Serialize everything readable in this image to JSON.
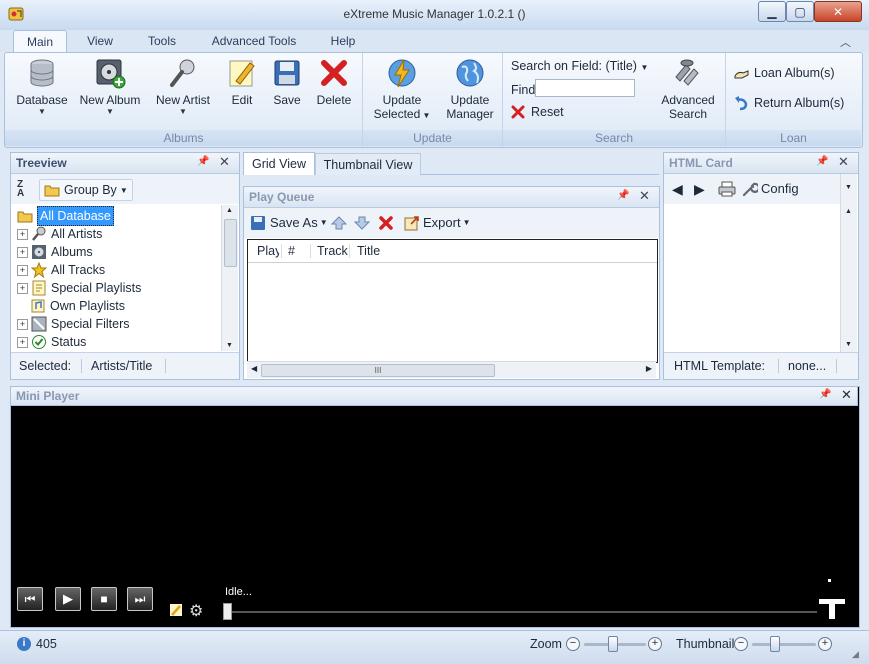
{
  "window": {
    "title": "eXtreme Music Manager 1.0.2.1 ()"
  },
  "tabs": [
    "Main",
    "View",
    "Tools",
    "Advanced Tools",
    "Help"
  ],
  "ribbon": {
    "albums": {
      "label": "Albums",
      "database": "Database",
      "new_album": "New Album",
      "new_artist": "New Artist",
      "edit": "Edit",
      "save": "Save",
      "delete": "Delete"
    },
    "update": {
      "label": "Update",
      "update_selected_1": "Update",
      "update_selected_2": "Selected",
      "update_manager_1": "Update",
      "update_manager_2": "Manager"
    },
    "search": {
      "label": "Search",
      "field_label": "Search on Field: (Title)",
      "find_label": "Find",
      "find_value": "",
      "reset": "Reset",
      "advanced_1": "Advanced",
      "advanced_2": "Search"
    },
    "loan": {
      "label": "Loan",
      "loan_albums": "Loan Album(s)",
      "return_albums": "Return Album(s)"
    }
  },
  "treeview": {
    "title": "Treeview",
    "group_by": "Group By",
    "items": [
      "All Database",
      "All Artists",
      "Albums",
      "All Tracks",
      "Special Playlists",
      "Own Playlists",
      "Special Filters",
      "Status"
    ],
    "selected_label": "Selected:",
    "selected_value": "Artists/Title"
  },
  "center": {
    "tab_grid": "Grid View",
    "tab_thumb": "Thumbnail View",
    "play_queue": "Play Queue",
    "save_as": "Save As",
    "export": "Export",
    "columns": [
      "Play",
      "#",
      "Track",
      "Title"
    ],
    "hscroll_grip": "III"
  },
  "html_card": {
    "title": "HTML Card",
    "config": "Config",
    "template_label": "HTML Template:",
    "template_value": "none..."
  },
  "mini_player": {
    "title": "Mini Player",
    "status": "Idle..."
  },
  "statusbar": {
    "count": "405",
    "zoom": "Zoom",
    "thumbnail": "Thumbnail",
    "minus": "−",
    "plus": "+"
  },
  "colors": {
    "accent": "#3a78c8",
    "selection": "#3399ff",
    "delete_red": "#d42020",
    "frame": "#a9c1df"
  }
}
